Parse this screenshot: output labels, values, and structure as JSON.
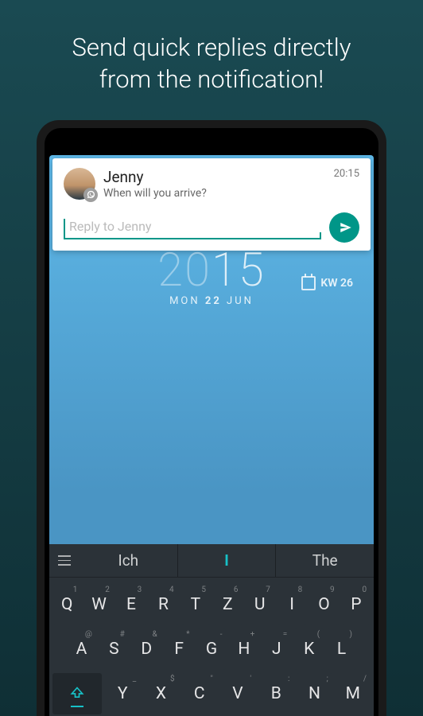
{
  "promo": {
    "title_l1": "Send quick replies directly",
    "title_l2": "from the notification!"
  },
  "notification": {
    "sender": "Jenny",
    "message": "When will you arrive?",
    "time": "20:15",
    "reply_placeholder": "Reply to Jenny"
  },
  "lockscreen": {
    "hour": "20",
    "minute": "15",
    "dow": "MON",
    "day": "22",
    "month": "JUN",
    "week_label": "KW 26"
  },
  "keyboard": {
    "suggestions": [
      "Ich",
      "I",
      "The"
    ],
    "row1": [
      {
        "k": "Q",
        "a": "1"
      },
      {
        "k": "W",
        "a": "2"
      },
      {
        "k": "E",
        "a": "3"
      },
      {
        "k": "R",
        "a": "4"
      },
      {
        "k": "T",
        "a": "5"
      },
      {
        "k": "Z",
        "a": "6"
      },
      {
        "k": "U",
        "a": "7"
      },
      {
        "k": "I",
        "a": "8"
      },
      {
        "k": "O",
        "a": "9"
      },
      {
        "k": "P",
        "a": "0"
      }
    ],
    "row2": [
      {
        "k": "A",
        "a": "@"
      },
      {
        "k": "S",
        "a": "#"
      },
      {
        "k": "D",
        "a": "&"
      },
      {
        "k": "F",
        "a": "*"
      },
      {
        "k": "G",
        "a": "-"
      },
      {
        "k": "H",
        "a": "+"
      },
      {
        "k": "J",
        "a": "="
      },
      {
        "k": "K",
        "a": "("
      },
      {
        "k": "L",
        "a": ")"
      }
    ],
    "row3": [
      {
        "k": "Y",
        "a": "_"
      },
      {
        "k": "X",
        "a": "$"
      },
      {
        "k": "C",
        "a": "\""
      },
      {
        "k": "V",
        "a": "'"
      },
      {
        "k": "B",
        "a": ":"
      },
      {
        "k": "N",
        "a": ";"
      },
      {
        "k": "M",
        "a": "/"
      }
    ]
  }
}
